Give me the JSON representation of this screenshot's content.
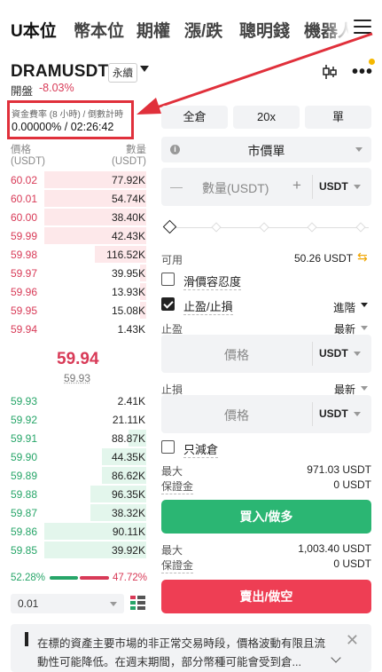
{
  "tabs": [
    {
      "label": "U本位",
      "active": true
    },
    {
      "label": "幣本位",
      "active": false
    },
    {
      "label": "期權",
      "active": false
    },
    {
      "label": "漲/跌",
      "active": false
    },
    {
      "label": "聰明錢",
      "active": false
    },
    {
      "label": "機器人",
      "active": false
    }
  ],
  "header": {
    "symbol": "DRAMUSDT",
    "contract_type": "永續",
    "open_label": "開盤",
    "open_change": "-8.03%"
  },
  "funding": {
    "label": "資金費率 (8 小時) / 倒數計時",
    "value": "0.00000% / 02:26:42"
  },
  "orderbook": {
    "price_header": "價格",
    "price_unit": "(USDT)",
    "qty_header": "數量",
    "qty_unit": "(USDT)",
    "asks": [
      {
        "price": "60.02",
        "qty": "77.92K",
        "depth": 0.7
      },
      {
        "price": "60.01",
        "qty": "54.74K",
        "depth": 0.7
      },
      {
        "price": "60.00",
        "qty": "38.40K",
        "depth": 0.7
      },
      {
        "price": "59.99",
        "qty": "42.43K",
        "depth": 0.7
      },
      {
        "price": "59.98",
        "qty": "116.52K",
        "depth": 0.35
      },
      {
        "price": "59.97",
        "qty": "39.95K",
        "depth": 0.04
      },
      {
        "price": "59.96",
        "qty": "13.93K",
        "depth": 0.04
      },
      {
        "price": "59.95",
        "qty": "15.08K",
        "depth": 0.04
      },
      {
        "price": "59.94",
        "qty": "1.43K",
        "depth": 0.0
      }
    ],
    "last_price": "59.94",
    "mark_price": "59.93",
    "bids": [
      {
        "price": "59.93",
        "qty": "2.41K",
        "depth": 0.0
      },
      {
        "price": "59.92",
        "qty": "21.11K",
        "depth": 0.0
      },
      {
        "price": "59.91",
        "qty": "88.87K",
        "depth": 0.12
      },
      {
        "price": "59.90",
        "qty": "44.35K",
        "depth": 0.3
      },
      {
        "price": "59.89",
        "qty": "86.62K",
        "depth": 0.3
      },
      {
        "price": "59.88",
        "qty": "96.35K",
        "depth": 0.38
      },
      {
        "price": "59.87",
        "qty": "38.32K",
        "depth": 0.38
      },
      {
        "price": "59.86",
        "qty": "90.11K",
        "depth": 0.7
      },
      {
        "price": "59.85",
        "qty": "39.92K",
        "depth": 0.7
      }
    ],
    "buy_ratio": "52.28%",
    "sell_ratio": "47.72%",
    "precision": "0.01"
  },
  "order": {
    "margin_mode": "全倉",
    "leverage": "20x",
    "position_mode": "單",
    "order_type": "市價單",
    "qty_placeholder": "數量(USDT)",
    "qty_minus": "—",
    "qty_plus": "+",
    "qty_unit": "USDT",
    "available_label": "可用",
    "available_value": "50.26 USDT",
    "slippage_label": "滑價容忍度",
    "tpsl_label": "止盈/止損",
    "advanced_label": "進階",
    "tp_label": "止盈",
    "tp_trigger": "最新",
    "tp_placeholder": "價格",
    "tp_unit": "USDT",
    "sl_label": "止損",
    "sl_trigger": "最新",
    "sl_placeholder": "價格",
    "sl_unit": "USDT",
    "reduce_only_label": "只減倉",
    "buy_max_label": "最大",
    "buy_max_value": "971.03 USDT",
    "buy_margin_label": "保證金",
    "buy_margin_value": "0 USDT",
    "buy_button": "買入/做多",
    "sell_max_label": "最大",
    "sell_max_value": "1,003.40 USDT",
    "sell_margin_label": "保證金",
    "sell_margin_value": "0 USDT",
    "sell_button": "賣出/做空"
  },
  "notice": {
    "text": "在標的資產主要市場的非正常交易時段，價格波動有限且流動性可能降低。在週末期間，部分幣種可能會受到倉..."
  },
  "icons": {
    "menu": "hamburger-icon",
    "chart": "candlestick-icon",
    "more": "more-dots-icon",
    "swap": "transfer-icon",
    "close": "close-icon"
  },
  "colors": {
    "buy": "#2bb673",
    "sell": "#ee3e54",
    "annotation": "#e0303b",
    "accent": "#f0a500"
  }
}
